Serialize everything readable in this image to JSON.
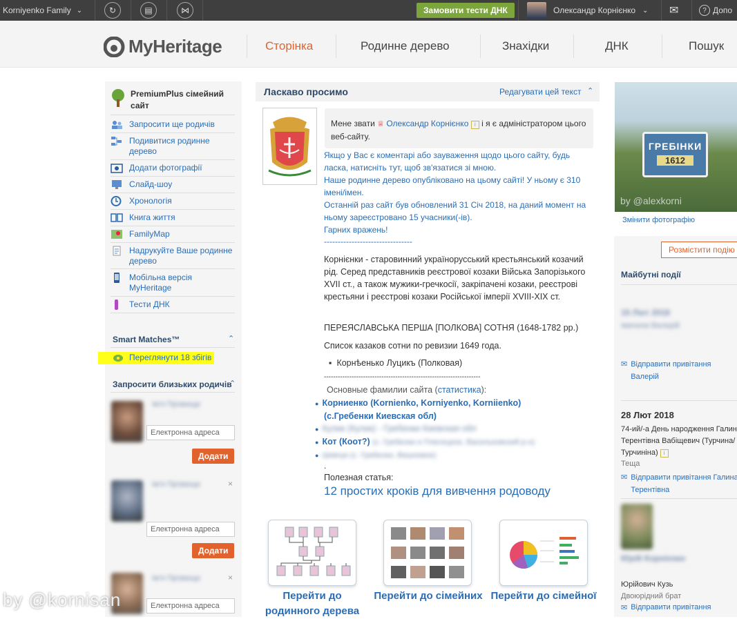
{
  "topbar": {
    "site_name": "Korniyenko Family",
    "dna_button": "Замовити тести ДНК",
    "user_name": "Олександр Корнієнко",
    "help_label": "Допо"
  },
  "header": {
    "logo_text": "MyHeritage",
    "nav": [
      "Сторінка",
      "Родинне дерево",
      "Знахідки",
      "ДНК",
      "Пошук"
    ]
  },
  "sidebar": {
    "premium_title": "PremiumPlus сімейний сайт",
    "items": [
      {
        "label": "Запросити ще родичів",
        "icon": "invite-icon"
      },
      {
        "label": "Подивитися родинне дерево",
        "icon": "tree-icon"
      },
      {
        "label": "Додати фотографії",
        "icon": "photos-icon"
      },
      {
        "label": "Слайд-шоу",
        "icon": "slideshow-icon"
      },
      {
        "label": "Хронологія",
        "icon": "timeline-icon"
      },
      {
        "label": "Книга життя",
        "icon": "book-icon"
      },
      {
        "label": "FamilyMap",
        "icon": "map-icon"
      },
      {
        "label": "Надрукуйте Ваше родинне дерево",
        "icon": "print-icon"
      },
      {
        "label": "Мобільна версія MyHeritage",
        "icon": "mobile-icon"
      },
      {
        "label": "Тести ДНК",
        "icon": "dna-icon"
      }
    ],
    "smart_matches_title": "Smart Matches™",
    "smart_matches_link": "Переглянути 18 збігів",
    "invite_title": "Запросити близьких родичів",
    "email_placeholder": "Електронна адреса",
    "add_button": "Додати",
    "blurred_name": "Ім'я Прізвище"
  },
  "welcome": {
    "title": "Ласкаво просимо",
    "edit_link": "Редагувати цей текст",
    "intro_prefix": "Мене звати",
    "intro_name": "Олександр Корнієнко",
    "intro_suffix": "і я є адміністратором цього веб-сайту.",
    "comment_line": "Якщо у Вас є коментарі або зауваження щодо цього сайту, будь ласка, натисніть тут, щоб зв'язатися зі мною.",
    "published_line": "Наше родинне дерево опубліковано на цьому сайті! У ньому є 310 імені/імен.",
    "updated_line": "Останній раз сайт був обновлений 31 Січ 2018, на даний момент на ньому зареєстровано 15 учасники(-ів).",
    "greeting": "Гарних вражень!",
    "dashes1": "--------------------------------",
    "history": "Корнієнки - старовинний українорусський крестьянський козачий рід. Серед представників реєстрової козаки Війська Запорізького XVII ст., а також мужики-гречкосії, закріпачені козаки, реєстрові крестьяни і реєстрові козаки Російської імперії XVIII-XIX ст.",
    "sotnya": "ПЕРЕЯСЛАВСЬКА ПЕРША [ПОЛКОВА] СОТНЯ (1648-1782 рр.)",
    "kozaky_list": "Список казаков сотни по ревизии 1649 года.",
    "bullet": "Корнѣенько Луцикъ (Полковая)",
    "dashes2": "--------------------------------------------------------------------",
    "families_prefix": "Основные фамилии сайта (",
    "families_stats": "статистика",
    "families_suffix": "):",
    "family1": "Корниенко (Kornienko, Korniyenko, Korniienko)",
    "family1b": "(с.Гребенки Киевская обл)",
    "family2_blur": "Кулик (Кулик) - Гребенки Киевская обл",
    "family3": "Кот (Коот?)",
    "family3_blur": "(с. Гребенки и Плесецкое, Васильковский р-н)",
    "family4_blur": "Шевчук (с. Гребенки, Вишневое)",
    "dot": ".",
    "useful_label": "Полезная статья:",
    "useful_link": "12 простих кроків для вивчення родоводу"
  },
  "cards": [
    {
      "label": "Перейти до родинного дерева",
      "icon": "family-tree-icon"
    },
    {
      "label": "Перейти до сімейних",
      "icon": "photo-gallery-icon"
    },
    {
      "label": "Перейти до сімейної",
      "icon": "statistics-icon"
    }
  ],
  "rightcol": {
    "sign_line1": "ГРЕБІНКИ",
    "sign_line2": "1612",
    "watermark": "by @alexkorni",
    "change_photo": "Змінити фотографію",
    "post_event": "Розмістити подію",
    "upcoming_title": "Майбутні події",
    "ev1_date_blur": "15 Лют 2018",
    "ev1_text_blur": "Іменини Валерій",
    "send_greeting": "Відправити привітання",
    "ev1_person": "Валерій",
    "ev2_date": "28 Лют 2018",
    "ev2_text": "74-ий/-а День народження Галина Терентівна Вабіщевич (Турчина/ Турчиніна)",
    "ev2_relation": "Теща",
    "ev2_send": "Відправити привітання Галина Терентівна",
    "ev3_blur": "Юрій Корнієнко",
    "ev3_name": "Юрійович Кузь",
    "ev3_relation": "Двоюрідний брат",
    "ev3_send": "Відправити привітання"
  },
  "watermark_bottom": "by @kornisan",
  "colors": {
    "accent": "#e2622d",
    "link": "#2a6db5",
    "dna": "#7ca53c",
    "topbar": "#3f3f3f"
  }
}
